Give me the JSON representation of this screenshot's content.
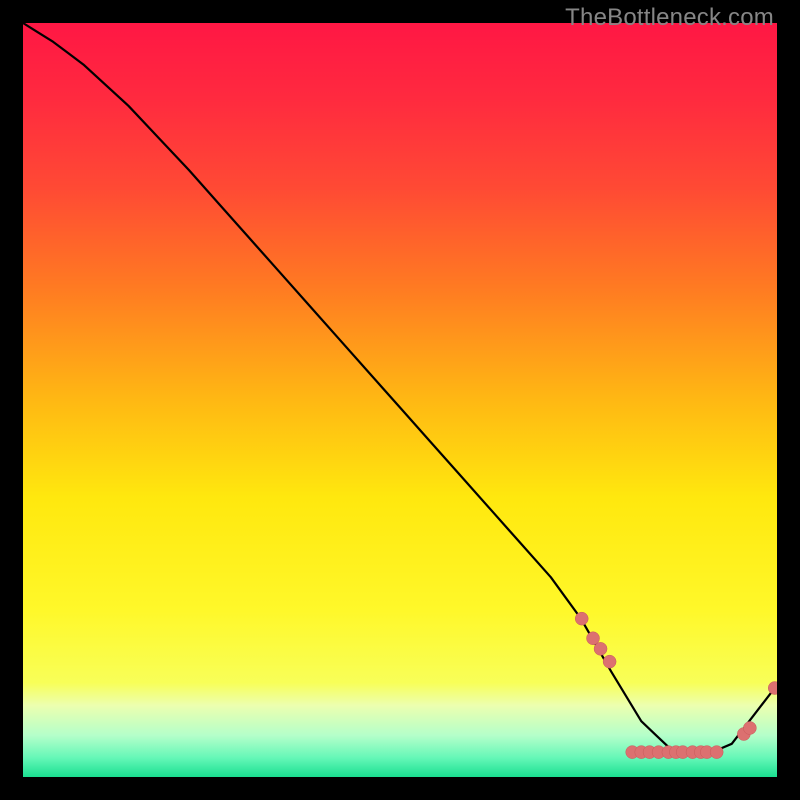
{
  "watermark": "TheBottleneck.com",
  "colors": {
    "dot_fill": "#dc7070",
    "dot_stroke": "#c85a5a",
    "curve": "#000000",
    "background": "#000000"
  },
  "gradient_stops": [
    {
      "offset": 0.0,
      "color": "#ff1744"
    },
    {
      "offset": 0.1,
      "color": "#ff2a3f"
    },
    {
      "offset": 0.22,
      "color": "#ff4a34"
    },
    {
      "offset": 0.35,
      "color": "#ff7a22"
    },
    {
      "offset": 0.5,
      "color": "#ffb813"
    },
    {
      "offset": 0.63,
      "color": "#ffe80e"
    },
    {
      "offset": 0.78,
      "color": "#fff82a"
    },
    {
      "offset": 0.875,
      "color": "#f8ff58"
    },
    {
      "offset": 0.905,
      "color": "#ecffaf"
    },
    {
      "offset": 0.945,
      "color": "#b4ffca"
    },
    {
      "offset": 0.975,
      "color": "#64f7b7"
    },
    {
      "offset": 1.0,
      "color": "#1adf90"
    }
  ],
  "chart_data": {
    "type": "line",
    "title": "",
    "xlabel": "",
    "ylabel": "",
    "xlim": [
      0,
      100
    ],
    "ylim": [
      0,
      100
    ],
    "series": [
      {
        "name": "curve",
        "x": [
          0,
          4,
          8,
          14,
          22,
          30,
          38,
          46,
          54,
          62,
          70,
          74,
          78,
          82,
          86,
          90,
          94,
          100
        ],
        "y": [
          100,
          97.5,
          94.5,
          89,
          80.5,
          71.5,
          62.5,
          53.5,
          44.5,
          35.5,
          26.5,
          21,
          14,
          7.4,
          3.6,
          2.7,
          4.4,
          12.2
        ]
      },
      {
        "name": "dots-cluster-left",
        "x": [
          74.1,
          75.6,
          76.6,
          77.8
        ],
        "y": [
          21.0,
          18.4,
          17.0,
          15.3
        ]
      },
      {
        "name": "dots-bottom",
        "x": [
          80.8,
          82.0,
          83.1,
          84.3,
          85.6,
          86.6,
          87.5,
          88.8,
          89.9,
          90.7,
          92.0
        ],
        "y": [
          3.3,
          3.3,
          3.3,
          3.3,
          3.3,
          3.3,
          3.3,
          3.3,
          3.3,
          3.3,
          3.3
        ]
      },
      {
        "name": "dots-cluster-right",
        "x": [
          95.6,
          96.4,
          99.7
        ],
        "y": [
          5.7,
          6.5,
          11.8
        ]
      }
    ]
  }
}
